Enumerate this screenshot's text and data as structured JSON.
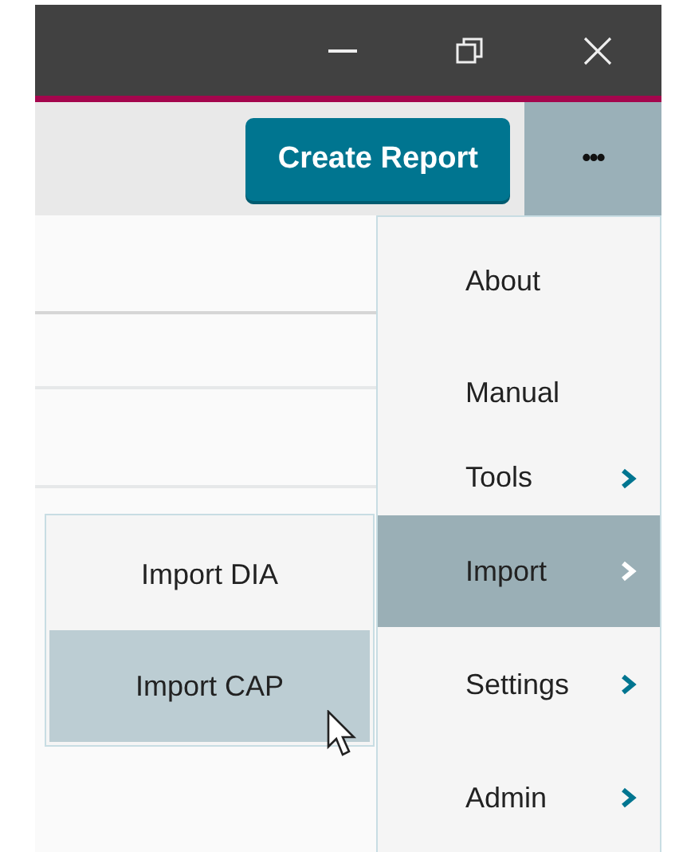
{
  "toolbar": {
    "primary_button": "Create Report",
    "more_button": "•••"
  },
  "menu": {
    "items": [
      {
        "label": "About",
        "has_submenu": false,
        "selected": false
      },
      {
        "label": "Manual",
        "has_submenu": false,
        "selected": false
      },
      {
        "label": "Tools",
        "has_submenu": true,
        "selected": false
      },
      {
        "label": "Import",
        "has_submenu": true,
        "selected": true
      },
      {
        "label": "Settings",
        "has_submenu": true,
        "selected": false
      },
      {
        "label": "Admin",
        "has_submenu": true,
        "selected": false
      }
    ]
  },
  "submenu": {
    "items": [
      {
        "label": "Import DIA",
        "selected": false
      },
      {
        "label": "Import CAP",
        "selected": true
      }
    ]
  }
}
